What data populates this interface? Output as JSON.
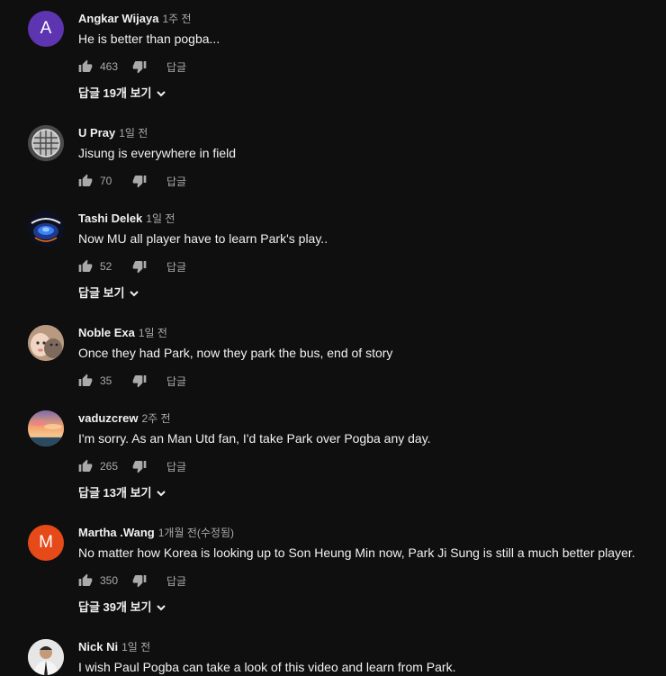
{
  "reply_label": "답글",
  "comments": [
    {
      "author": "Angkar Wijaya",
      "time": "1주 전",
      "text": "He is better than pogba...",
      "likes": "463",
      "avatar_letter": "A",
      "avatar_color": "#5e35b1",
      "view_replies": "답글 19개 보기"
    },
    {
      "author": "U Pray",
      "time": "1일 전",
      "text": "Jisung is everywhere in field",
      "likes": "70"
    },
    {
      "author": "Tashi Delek",
      "time": "1일 전",
      "text": "Now MU all player have to learn Park's play..",
      "likes": "52",
      "view_replies": "답글 보기"
    },
    {
      "author": "Noble Exa",
      "time": "1일 전",
      "text": "Once they had Park, now they park the bus, end of story",
      "likes": "35"
    },
    {
      "author": "vaduzcrew",
      "time": "2주 전",
      "text": "I'm sorry. As an Man Utd fan, I'd take Park over Pogba any day.",
      "likes": "265",
      "view_replies": "답글 13개 보기"
    },
    {
      "author": "Martha .Wang",
      "time": "1개월 전(수정됨)",
      "text": "No matter how Korea is looking up to Son Heung Min now, Park Ji Sung is still a much better player.",
      "likes": "350",
      "avatar_letter": "M",
      "avatar_color": "#e64a19",
      "view_replies": "답글 39개 보기"
    },
    {
      "author": "Nick Ni",
      "time": "1일 전",
      "text": "I wish Paul Pogba can take a look of this video and learn from Park."
    }
  ],
  "icons": {
    "like": "thumb-up-icon",
    "dislike": "thumb-down-icon",
    "chevron": "chevron-down-icon"
  }
}
